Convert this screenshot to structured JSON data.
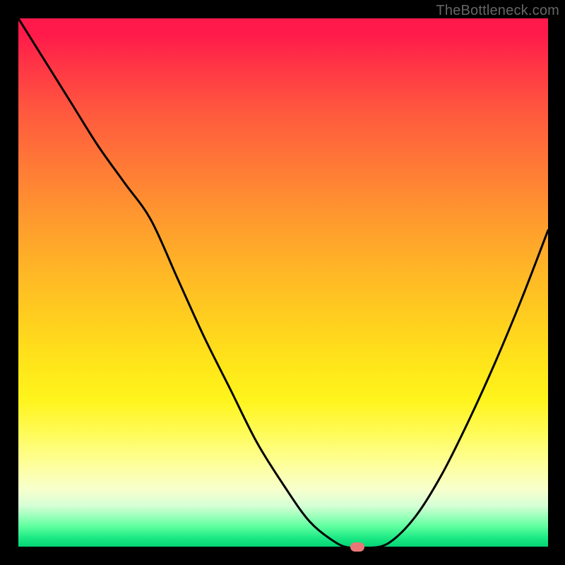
{
  "caption": "TheBottleneck.com",
  "colors": {
    "page_bg": "#000000",
    "curve": "#000000",
    "marker": "#e97777"
  },
  "chart_data": {
    "type": "line",
    "title": "",
    "xlabel": "",
    "ylabel": "",
    "xlim": [
      0,
      100
    ],
    "ylim": [
      0,
      100
    ],
    "x": [
      0,
      5,
      10,
      15,
      20,
      25,
      30,
      35,
      40,
      45,
      50,
      55,
      60,
      63,
      66,
      70,
      75,
      80,
      85,
      90,
      95,
      100
    ],
    "values": [
      100,
      92,
      84,
      76,
      69,
      62,
      51,
      40,
      30,
      20,
      12,
      5,
      1,
      0,
      0,
      1,
      6,
      14,
      24,
      35,
      47,
      60
    ],
    "minimum_x": 64,
    "minimum_y": 0,
    "background": "vertical gradient red→orange→yellow→green",
    "grid": false,
    "legend": false,
    "annotations": [
      {
        "type": "marker",
        "x": 65,
        "y": 0,
        "shape": "rounded-pill"
      }
    ]
  }
}
